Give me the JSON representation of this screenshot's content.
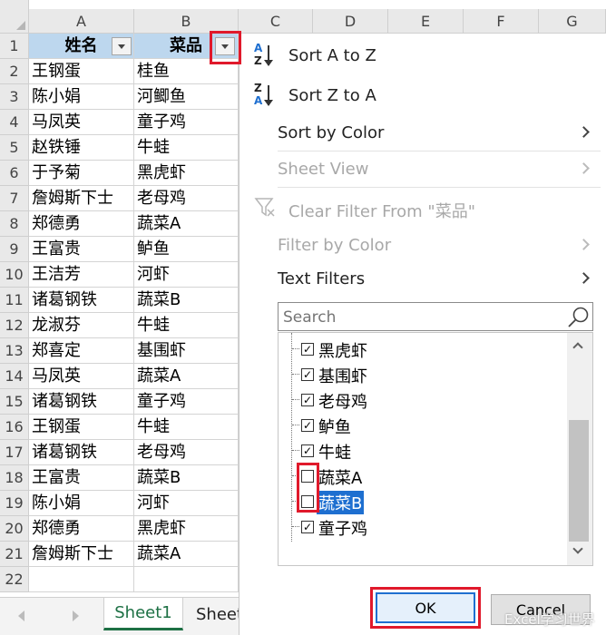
{
  "columns": [
    "A",
    "B",
    "C",
    "D",
    "E",
    "F",
    "G"
  ],
  "rows": [
    {
      "num": "1",
      "a": "姓名",
      "b": "菜品"
    },
    {
      "num": "2",
      "a": "王钢蛋",
      "b": "桂鱼"
    },
    {
      "num": "3",
      "a": "陈小娟",
      "b": "河鲫鱼"
    },
    {
      "num": "4",
      "a": "马凤英",
      "b": "童子鸡"
    },
    {
      "num": "5",
      "a": "赵铁锤",
      "b": "牛蛙"
    },
    {
      "num": "6",
      "a": "于予菊",
      "b": "黑虎虾"
    },
    {
      "num": "7",
      "a": "詹姆斯下士",
      "b": "老母鸡"
    },
    {
      "num": "8",
      "a": "郑德勇",
      "b": "蔬菜A"
    },
    {
      "num": "9",
      "a": "王富贵",
      "b": "鲈鱼"
    },
    {
      "num": "10",
      "a": "王洁芳",
      "b": "河虾"
    },
    {
      "num": "11",
      "a": "诸葛钢铁",
      "b": "蔬菜B"
    },
    {
      "num": "12",
      "a": "龙淑芬",
      "b": "牛蛙"
    },
    {
      "num": "13",
      "a": "郑喜定",
      "b": "基围虾"
    },
    {
      "num": "14",
      "a": "马凤英",
      "b": "蔬菜A"
    },
    {
      "num": "15",
      "a": "诸葛钢铁",
      "b": "童子鸡"
    },
    {
      "num": "16",
      "a": "王钢蛋",
      "b": "牛蛙"
    },
    {
      "num": "17",
      "a": "诸葛钢铁",
      "b": "老母鸡"
    },
    {
      "num": "18",
      "a": "王富贵",
      "b": "蔬菜B"
    },
    {
      "num": "19",
      "a": "陈小娟",
      "b": "河虾"
    },
    {
      "num": "20",
      "a": "郑德勇",
      "b": "黑虎虾"
    },
    {
      "num": "21",
      "a": "詹姆斯下士",
      "b": "蔬菜A"
    },
    {
      "num": "22",
      "a": "",
      "b": ""
    }
  ],
  "tabs": {
    "active": "Sheet1",
    "next": "Sheet"
  },
  "menu": {
    "sort_az": "Sort A to Z",
    "sort_za": "Sort Z to A",
    "sort_by_color": "Sort by Color",
    "sheet_view": "Sheet View",
    "clear_filter": "Clear Filter From \"菜品\"",
    "filter_by_color": "Filter by Color",
    "text_filters": "Text Filters",
    "search_placeholder": "Search",
    "az_top": "A",
    "az_bottom": "Z",
    "za_top": "Z",
    "za_bottom": "A"
  },
  "filter_items": [
    {
      "label": "黑虎虾",
      "checked": true
    },
    {
      "label": "基围虾",
      "checked": true
    },
    {
      "label": "老母鸡",
      "checked": true
    },
    {
      "label": "鲈鱼",
      "checked": true
    },
    {
      "label": "牛蛙",
      "checked": true
    },
    {
      "label": "蔬菜A",
      "checked": false
    },
    {
      "label": "蔬菜B",
      "checked": false
    },
    {
      "label": "童子鸡",
      "checked": true
    }
  ],
  "buttons": {
    "ok": "OK",
    "cancel": "Cancel"
  },
  "watermark": "Excel学习世界",
  "colors": {
    "header_fill": "#bdd7ee",
    "highlight": "#1e6fd0",
    "annotation_red": "#e0192b"
  }
}
